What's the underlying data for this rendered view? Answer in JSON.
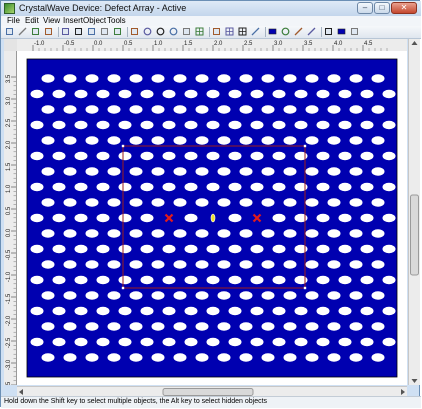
{
  "window": {
    "title": "CrystalWave Device: Defect Array - Active",
    "controls": {
      "minimize": "–",
      "maximize": "□",
      "close": "✕"
    }
  },
  "menu": [
    "File",
    "Edit",
    "View",
    "Insert",
    "Object",
    "Tools"
  ],
  "toolbar": {
    "icons": [
      "new-icon",
      "open-icon",
      "save-icon",
      "print-icon",
      "cut-icon",
      "copy-icon",
      "paste-icon",
      "undo-icon",
      "redo-icon",
      "pointer-icon",
      "rotate-icon",
      "zoom-in-icon",
      "zoom-out-icon",
      "pan-icon",
      "grid-icon",
      "fit-icon",
      "snap-icon",
      "align-icon",
      "pen-icon",
      "shape-rect-icon",
      "shape-ellipse-icon",
      "line-icon",
      "arrow-icon",
      "properties-icon",
      "image-icon",
      "settings-icon"
    ]
  },
  "rulers": {
    "top_labels": [
      "-1.0",
      "-0.5",
      "0.0",
      "0.5",
      "1.0",
      "1.5",
      "2.0",
      "2.5",
      "3.0",
      "3.5",
      "4.0",
      "4.5"
    ],
    "left_labels": [
      "3.5",
      "3.0",
      "2.5",
      "2.0",
      "1.5",
      "1.0",
      "0.5",
      "0.0",
      "-0.5",
      "-1.0",
      "-1.5",
      "-2.0",
      "-2.5",
      "-3.0",
      "-3.5"
    ]
  },
  "colors": {
    "substrate": "#0000b0",
    "hole": "#ffffff",
    "defect": "#e21b1b",
    "selection": "#9b1b1b"
  },
  "status": {
    "text": "Hold down the Shift key to select multiple objects, the Alt key to select hidden objects"
  }
}
